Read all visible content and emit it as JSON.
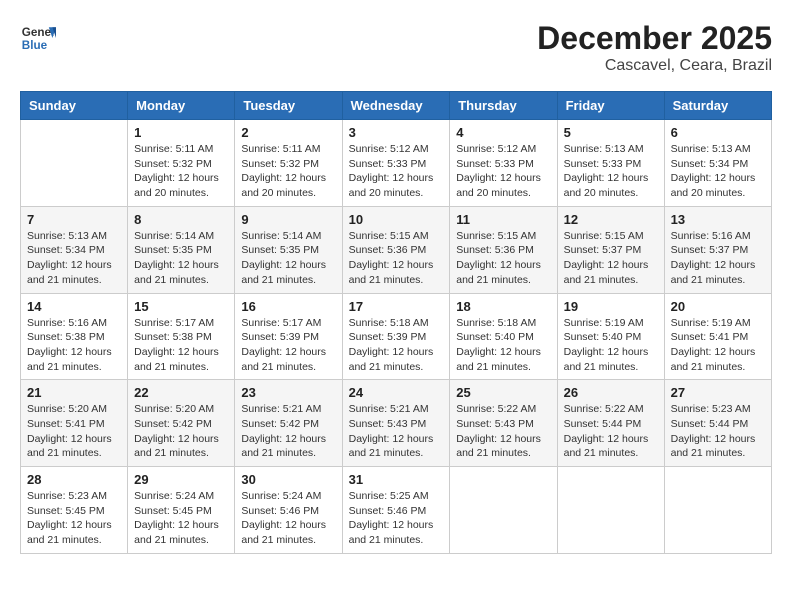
{
  "header": {
    "logo_general": "General",
    "logo_blue": "Blue",
    "month_title": "December 2025",
    "location": "Cascavel, Ceara, Brazil"
  },
  "weekdays": [
    "Sunday",
    "Monday",
    "Tuesday",
    "Wednesday",
    "Thursday",
    "Friday",
    "Saturday"
  ],
  "weeks": [
    [
      {
        "day": "",
        "info": ""
      },
      {
        "day": "1",
        "info": "Sunrise: 5:11 AM\nSunset: 5:32 PM\nDaylight: 12 hours\nand 20 minutes."
      },
      {
        "day": "2",
        "info": "Sunrise: 5:11 AM\nSunset: 5:32 PM\nDaylight: 12 hours\nand 20 minutes."
      },
      {
        "day": "3",
        "info": "Sunrise: 5:12 AM\nSunset: 5:33 PM\nDaylight: 12 hours\nand 20 minutes."
      },
      {
        "day": "4",
        "info": "Sunrise: 5:12 AM\nSunset: 5:33 PM\nDaylight: 12 hours\nand 20 minutes."
      },
      {
        "day": "5",
        "info": "Sunrise: 5:13 AM\nSunset: 5:33 PM\nDaylight: 12 hours\nand 20 minutes."
      },
      {
        "day": "6",
        "info": "Sunrise: 5:13 AM\nSunset: 5:34 PM\nDaylight: 12 hours\nand 20 minutes."
      }
    ],
    [
      {
        "day": "7",
        "info": "Sunrise: 5:13 AM\nSunset: 5:34 PM\nDaylight: 12 hours\nand 21 minutes."
      },
      {
        "day": "8",
        "info": "Sunrise: 5:14 AM\nSunset: 5:35 PM\nDaylight: 12 hours\nand 21 minutes."
      },
      {
        "day": "9",
        "info": "Sunrise: 5:14 AM\nSunset: 5:35 PM\nDaylight: 12 hours\nand 21 minutes."
      },
      {
        "day": "10",
        "info": "Sunrise: 5:15 AM\nSunset: 5:36 PM\nDaylight: 12 hours\nand 21 minutes."
      },
      {
        "day": "11",
        "info": "Sunrise: 5:15 AM\nSunset: 5:36 PM\nDaylight: 12 hours\nand 21 minutes."
      },
      {
        "day": "12",
        "info": "Sunrise: 5:15 AM\nSunset: 5:37 PM\nDaylight: 12 hours\nand 21 minutes."
      },
      {
        "day": "13",
        "info": "Sunrise: 5:16 AM\nSunset: 5:37 PM\nDaylight: 12 hours\nand 21 minutes."
      }
    ],
    [
      {
        "day": "14",
        "info": "Sunrise: 5:16 AM\nSunset: 5:38 PM\nDaylight: 12 hours\nand 21 minutes."
      },
      {
        "day": "15",
        "info": "Sunrise: 5:17 AM\nSunset: 5:38 PM\nDaylight: 12 hours\nand 21 minutes."
      },
      {
        "day": "16",
        "info": "Sunrise: 5:17 AM\nSunset: 5:39 PM\nDaylight: 12 hours\nand 21 minutes."
      },
      {
        "day": "17",
        "info": "Sunrise: 5:18 AM\nSunset: 5:39 PM\nDaylight: 12 hours\nand 21 minutes."
      },
      {
        "day": "18",
        "info": "Sunrise: 5:18 AM\nSunset: 5:40 PM\nDaylight: 12 hours\nand 21 minutes."
      },
      {
        "day": "19",
        "info": "Sunrise: 5:19 AM\nSunset: 5:40 PM\nDaylight: 12 hours\nand 21 minutes."
      },
      {
        "day": "20",
        "info": "Sunrise: 5:19 AM\nSunset: 5:41 PM\nDaylight: 12 hours\nand 21 minutes."
      }
    ],
    [
      {
        "day": "21",
        "info": "Sunrise: 5:20 AM\nSunset: 5:41 PM\nDaylight: 12 hours\nand 21 minutes."
      },
      {
        "day": "22",
        "info": "Sunrise: 5:20 AM\nSunset: 5:42 PM\nDaylight: 12 hours\nand 21 minutes."
      },
      {
        "day": "23",
        "info": "Sunrise: 5:21 AM\nSunset: 5:42 PM\nDaylight: 12 hours\nand 21 minutes."
      },
      {
        "day": "24",
        "info": "Sunrise: 5:21 AM\nSunset: 5:43 PM\nDaylight: 12 hours\nand 21 minutes."
      },
      {
        "day": "25",
        "info": "Sunrise: 5:22 AM\nSunset: 5:43 PM\nDaylight: 12 hours\nand 21 minutes."
      },
      {
        "day": "26",
        "info": "Sunrise: 5:22 AM\nSunset: 5:44 PM\nDaylight: 12 hours\nand 21 minutes."
      },
      {
        "day": "27",
        "info": "Sunrise: 5:23 AM\nSunset: 5:44 PM\nDaylight: 12 hours\nand 21 minutes."
      }
    ],
    [
      {
        "day": "28",
        "info": "Sunrise: 5:23 AM\nSunset: 5:45 PM\nDaylight: 12 hours\nand 21 minutes."
      },
      {
        "day": "29",
        "info": "Sunrise: 5:24 AM\nSunset: 5:45 PM\nDaylight: 12 hours\nand 21 minutes."
      },
      {
        "day": "30",
        "info": "Sunrise: 5:24 AM\nSunset: 5:46 PM\nDaylight: 12 hours\nand 21 minutes."
      },
      {
        "day": "31",
        "info": "Sunrise: 5:25 AM\nSunset: 5:46 PM\nDaylight: 12 hours\nand 21 minutes."
      },
      {
        "day": "",
        "info": ""
      },
      {
        "day": "",
        "info": ""
      },
      {
        "day": "",
        "info": ""
      }
    ]
  ]
}
